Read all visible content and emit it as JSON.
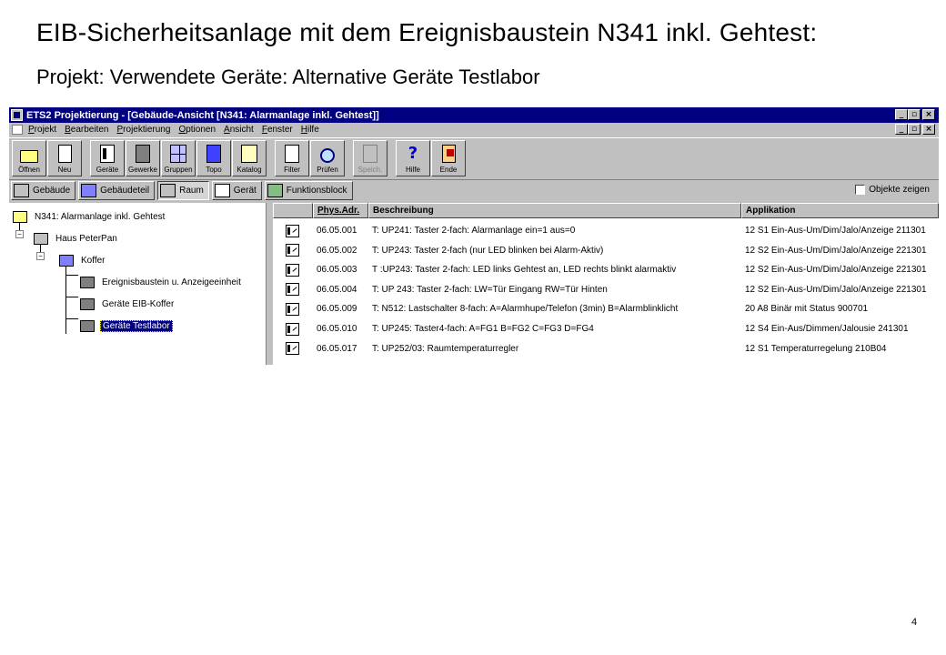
{
  "slide": {
    "title": "EIB-Sicherheitsanlage mit dem Ereignisbaustein N341 inkl. Gehtest:",
    "subtitle": "Projekt: Verwendete Geräte: Alternative Geräte Testlabor",
    "page_number": "4"
  },
  "window": {
    "title": "ETS2 Projektierung - [Gebäude-Ansicht [N341: Alarmanlage inkl. Gehtest]]",
    "controls": {
      "minimize": "_",
      "restore": "▫",
      "close": "×"
    }
  },
  "menu": [
    "Projekt",
    "Bearbeiten",
    "Projektierung",
    "Optionen",
    "Ansicht",
    "Fenster",
    "Hilfe"
  ],
  "toolbar": [
    {
      "label": "Öffnen",
      "icon": "open-folder-icon",
      "enabled": true
    },
    {
      "label": "Neu",
      "icon": "new-document-icon",
      "enabled": true
    },
    {
      "label": "Geräte",
      "icon": "devices-icon",
      "enabled": true
    },
    {
      "label": "Gewerke",
      "icon": "trades-tools-icon",
      "enabled": true
    },
    {
      "label": "Gruppen",
      "icon": "groups-icon",
      "enabled": true
    },
    {
      "label": "Topo",
      "icon": "topology-icon",
      "enabled": true
    },
    {
      "label": "Katalog",
      "icon": "catalog-book-icon",
      "enabled": true
    },
    {
      "label": "Filter",
      "icon": "filter-icon",
      "enabled": true
    },
    {
      "label": "Prüfen",
      "icon": "check-magnifier-icon",
      "enabled": true
    },
    {
      "label": "Speich.",
      "icon": "save-icon",
      "enabled": false
    },
    {
      "label": "Hilfe",
      "icon": "help-icon",
      "enabled": true
    },
    {
      "label": "Ende",
      "icon": "exit-door-icon",
      "enabled": true
    }
  ],
  "viewbar": {
    "buttons": [
      {
        "label": "Gebäude",
        "icon": "building-icon",
        "pressed": false
      },
      {
        "label": "Gebäudeteil",
        "icon": "building-part-icon",
        "pressed": false
      },
      {
        "label": "Raum",
        "icon": "room-icon",
        "pressed": true
      },
      {
        "label": "Gerät",
        "icon": "device-icon",
        "pressed": false
      },
      {
        "label": "Funktionsblock",
        "icon": "function-block-icon",
        "pressed": false
      }
    ],
    "objects_toggle": {
      "label": "Objekte zeigen",
      "checked": false
    }
  },
  "tree": {
    "root": "N341: Alarmanlage inkl. Gehtest",
    "building": "Haus PeterPan",
    "part": "Koffer",
    "rooms": [
      "Ereignisbaustein u. Anzeigeeinheit",
      "Geräte EIB-Koffer",
      "Geräte Testlabor"
    ],
    "selected_room": "Geräte Testlabor"
  },
  "device_list": {
    "columns": [
      "",
      "Phys.Adr.",
      "Beschreibung",
      "Applikation"
    ],
    "sorted_column": "Phys.Adr.",
    "rows": [
      {
        "addr": "06.05.001",
        "desc": "T: UP241: Taster 2-fach: Alarmanlage ein=1 aus=0",
        "app": "12 S1 Ein-Aus-Um/Dim/Jalo/Anzeige 211301"
      },
      {
        "addr": "06.05.002",
        "desc": "T: UP243: Taster 2-fach (nur LED blinken bei Alarm-Aktiv)",
        "app": "12 S2 Ein-Aus-Um/Dim/Jalo/Anzeige 221301"
      },
      {
        "addr": "06.05.003",
        "desc": "T :UP243: Taster 2-fach: LED links Gehtest an, LED rechts blinkt alarmaktiv",
        "app": "12 S2 Ein-Aus-Um/Dim/Jalo/Anzeige 221301"
      },
      {
        "addr": "06.05.004",
        "desc": "T: UP 243: Taster 2-fach: LW=Tür Eingang RW=Tür Hinten",
        "app": "12 S2 Ein-Aus-Um/Dim/Jalo/Anzeige 221301"
      },
      {
        "addr": "06.05.009",
        "desc": "T: N512: Lastschalter 8-fach: A=Alarmhupe/Telefon (3min) B=Alarmblinklicht",
        "app": "20 A8 Binär mit Status  900701"
      },
      {
        "addr": "06.05.010",
        "desc": "T: UP245: Taster4-fach: A=FG1 B=FG2 C=FG3 D=FG4",
        "app": "12 S4 Ein-Aus/Dimmen/Jalousie  241301"
      },
      {
        "addr": "06.05.017",
        "desc": "T: UP252/03: Raumtemperaturregler",
        "app": "12 S1 Temperaturregelung  210B04"
      }
    ]
  },
  "colors": {
    "titlebar": "#000080",
    "window_face": "#c0c0c0",
    "selection": "#000080"
  }
}
